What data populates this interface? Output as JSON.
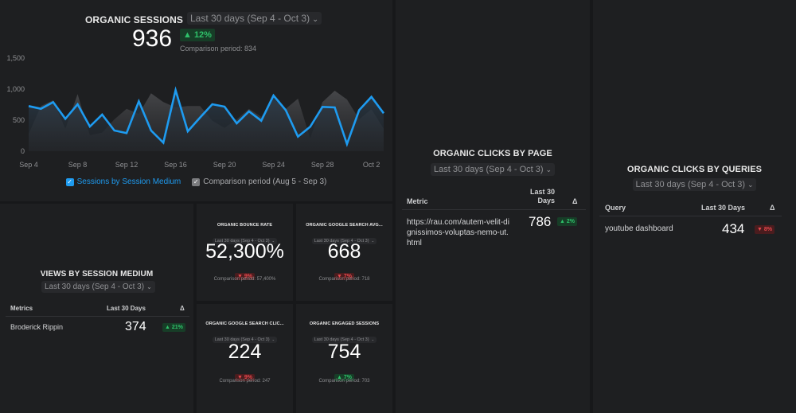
{
  "sessions": {
    "title": "ORGANIC SESSIONS",
    "date_range": "Last 30 days (Sep 4 - Oct 3)",
    "value": "936",
    "change": "▲ 12%",
    "change_direction": "up",
    "comparison": "Comparison period: 834",
    "legend": {
      "primary": "Sessions by Session Medium",
      "comparison": "Comparison period (Aug 5 - Sep 3)"
    }
  },
  "chart_data": {
    "type": "area",
    "title": "ORGANIC SESSIONS",
    "xlabel": "",
    "ylabel": "",
    "ylim": [
      0,
      1500
    ],
    "y_ticks": [
      "0",
      "500",
      "1,000",
      "1,500"
    ],
    "x_ticks": [
      "Sep 4",
      "Sep 8",
      "Sep 12",
      "Sep 16",
      "Sep 20",
      "Sep 24",
      "Sep 28",
      "Oct 2"
    ],
    "x": [
      "Sep 4",
      "Sep 5",
      "Sep 6",
      "Sep 7",
      "Sep 8",
      "Sep 9",
      "Sep 10",
      "Sep 11",
      "Sep 12",
      "Sep 13",
      "Sep 14",
      "Sep 15",
      "Sep 16",
      "Sep 17",
      "Sep 18",
      "Sep 19",
      "Sep 20",
      "Sep 21",
      "Sep 22",
      "Sep 23",
      "Sep 24",
      "Sep 25",
      "Sep 26",
      "Sep 27",
      "Sep 28",
      "Sep 29",
      "Sep 30",
      "Oct 1",
      "Oct 2",
      "Oct 3"
    ],
    "series": [
      {
        "name": "Sessions by Session Medium",
        "color": "#1e9bf0",
        "values": [
          727,
          683,
          790,
          522,
          756,
          397,
          590,
          333,
          291,
          804,
          333,
          137,
          983,
          320,
          542,
          756,
          718,
          449,
          641,
          491,
          897,
          662,
          235,
          393,
          714,
          705,
          115,
          662,
          876,
          611
        ]
      },
      {
        "name": "Comparison period (Aug 5 - Sep 3)",
        "color": "#6a6b6e",
        "values": [
          278,
          727,
          821,
          363,
          919,
          256,
          299,
          513,
          683,
          599,
          932,
          791,
          705,
          727,
          727,
          491,
          376,
          513,
          683,
          555,
          833,
          683,
          846,
          205,
          791,
          974,
          833,
          513,
          676,
          363
        ]
      }
    ],
    "legend": "bottom-center",
    "grid": false
  },
  "views": {
    "title": "VIEWS BY SESSION MEDIUM",
    "date_range": "Last 30 days (Sep 4 - Oct 3)",
    "columns": [
      "Metrics",
      "Last 30 Days",
      "Δ"
    ],
    "rows": [
      {
        "label": "Broderick Rippin",
        "value": "374",
        "change": "▲ 21%",
        "direction": "up"
      }
    ]
  },
  "kpis": [
    {
      "title": "ORGANIC BOUNCE RATE",
      "date_range": "Last 30 days (Sep 4 - Oct 3)",
      "value": "52,300%",
      "change": "▼ 9%",
      "direction": "down",
      "comparison": "Comparison period: 57,400%"
    },
    {
      "title": "ORGANIC GOOGLE SEARCH AVG...",
      "date_range": "Last 30 days (Sep 4 - Oct 3)",
      "value": "668",
      "change": "▼ 7%",
      "direction": "down",
      "comparison": "Comparison period: 718"
    },
    {
      "title": "ORGANIC GOOGLE SEARCH CLIC...",
      "date_range": "Last 30 days (Sep 4 - Oct 3)",
      "value": "224",
      "change": "▼ 9%",
      "direction": "down",
      "comparison": "Comparison period: 247"
    },
    {
      "title": "ORGANIC ENGAGED SESSIONS",
      "date_range": "Last 30 days (Sep 4 - Oct 3)",
      "value": "754",
      "change": "▲ 7%",
      "direction": "up",
      "comparison": "Comparison period: 703"
    }
  ],
  "clicks_by_page": {
    "title": "ORGANIC CLICKS BY PAGE",
    "date_range": "Last 30 days (Sep 4 - Oct 3)",
    "columns": [
      "Metric",
      "Last 30 Days",
      "Δ"
    ],
    "rows": [
      {
        "label": "https://rau.com/autem-velit-dignissimos-voluptas-nemo-ut.html",
        "value": "786",
        "change": "▲ 2%",
        "direction": "up"
      }
    ]
  },
  "clicks_by_queries": {
    "title": "ORGANIC CLICKS BY QUERIES",
    "date_range": "Last 30 days (Sep 4 - Oct 3)",
    "columns": [
      "Query",
      "Last 30 Days",
      "Δ"
    ],
    "rows": [
      {
        "label": "youtube dashboard",
        "value": "434",
        "change": "▼ 8%",
        "direction": "down"
      }
    ]
  },
  "icons": {
    "chevron": "⌄",
    "check": "✓"
  }
}
